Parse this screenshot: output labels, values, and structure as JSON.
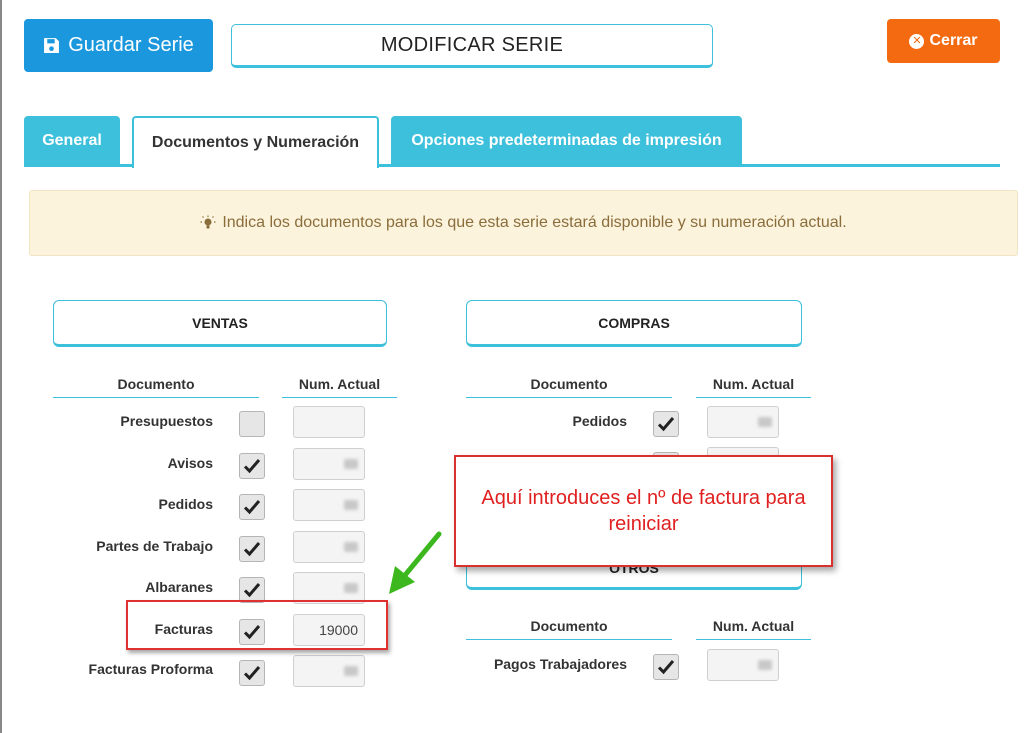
{
  "toolbar": {
    "save_label": "Guardar Serie",
    "title": "MODIFICAR SERIE",
    "close_label": "Cerrar"
  },
  "tabs": [
    {
      "label": "General"
    },
    {
      "label": "Documentos y Numeración"
    },
    {
      "label": "Opciones predeterminadas de impresión"
    }
  ],
  "info": "Indica los documentos para los que esta serie estará disponible y su numeración actual.",
  "ventas": {
    "title": "VENTAS",
    "col_doc": "Documento",
    "col_num": "Num. Actual",
    "rows": [
      {
        "label": "Presupuestos",
        "checked": false,
        "value": ""
      },
      {
        "label": "Avisos",
        "checked": true,
        "value": ""
      },
      {
        "label": "Pedidos",
        "checked": true,
        "value": ""
      },
      {
        "label": "Partes de Trabajo",
        "checked": true,
        "value": ""
      },
      {
        "label": "Albaranes",
        "checked": true,
        "value": ""
      },
      {
        "label": "Facturas",
        "checked": true,
        "value": "19000"
      },
      {
        "label": "Facturas Proforma",
        "checked": true,
        "value": ""
      }
    ]
  },
  "compras": {
    "title": "COMPRAS",
    "col_doc": "Documento",
    "col_num": "Num. Actual",
    "rows": [
      {
        "label": "Pedidos",
        "checked": true,
        "value": ""
      }
    ]
  },
  "otros": {
    "title": "OTROS",
    "col_doc": "Documento",
    "col_num": "Num. Actual",
    "rows": [
      {
        "label": "Pagos Trabajadores",
        "checked": true,
        "value": ""
      }
    ]
  },
  "annotation": {
    "text": "Aquí introduces el nº de factura para reiniciar"
  },
  "colors": {
    "primary": "#1a97dd",
    "accent": "#3cc0dc",
    "close": "#f36a10",
    "annotation": "#e02020",
    "arrow": "#3cb81e"
  }
}
